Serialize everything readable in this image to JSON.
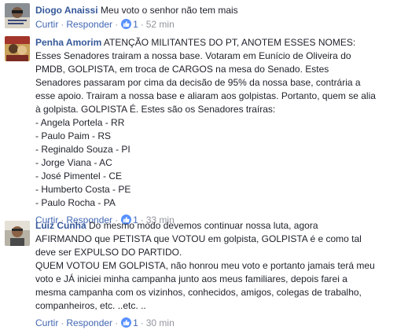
{
  "colors": {
    "link": "#4267b2",
    "author": "#365899",
    "meta": "#90949c",
    "text": "#1d2129",
    "like": "#5890ff"
  },
  "comments": [
    {
      "author": "Diogo Anaissi",
      "text_lines": [
        "Meu voto o senhor não tem mais"
      ],
      "actions": {
        "like": "Curtir",
        "reply": "Responder",
        "likes": "1",
        "time": "52 min"
      }
    },
    {
      "author": "Penha Amorim",
      "text_lines": [
        "ATENÇÃO MILITANTES DO PT, ANOTEM ESSES NOMES:",
        "Esses Senadores trairam a nossa base. Votaram em Eunício de Oliveira do",
        "PMDB, GOLPISTA, em troca de CARGOS na mesa do Senado. Estes",
        "Senadores passaram por cima da decisão de 95% da nossa base, contrária a",
        "esse apoio. Trairam a nossa base e aliaram aos golpistas. Portanto, quem se alia",
        "à golpista. GOLPISTA É. Estes são os Senadores traíras:",
        "- Angela Portela - RR",
        "- Paulo Paim - RS",
        "- Reginaldo Souza - PI",
        "- Jorge Viana - AC",
        "- José Pimentel - CE",
        "- Humberto Costa - PE",
        "- Paulo Rocha - PA"
      ],
      "actions": {
        "like": "Curtir",
        "reply": "Responder",
        "likes": "1",
        "time": "33 min"
      }
    },
    {
      "author": "Luiz Cunha",
      "text_lines": [
        "Do mesmo modo devemos continuar nossa luta, agora",
        "AFIRMANDO que PETISTA que VOTOU em golpista, GOLPISTA é e como tal",
        "deve ser EXPULSO DO PARTIDO.",
        "QUEM VOTOU EM GOLPISTA, não honrou meu voto e portanto jamais terá meu",
        "voto e JÁ iniciei minha campanha junto aos meus familiares, depois farei a",
        "mesma campanha com os vizinhos, conhecidos, amigos, colegas de trabalho,",
        "companheiros, etc. ..etc. .."
      ],
      "actions": {
        "like": "Curtir",
        "reply": "Responder",
        "likes": "1",
        "time": "30 min"
      }
    }
  ]
}
